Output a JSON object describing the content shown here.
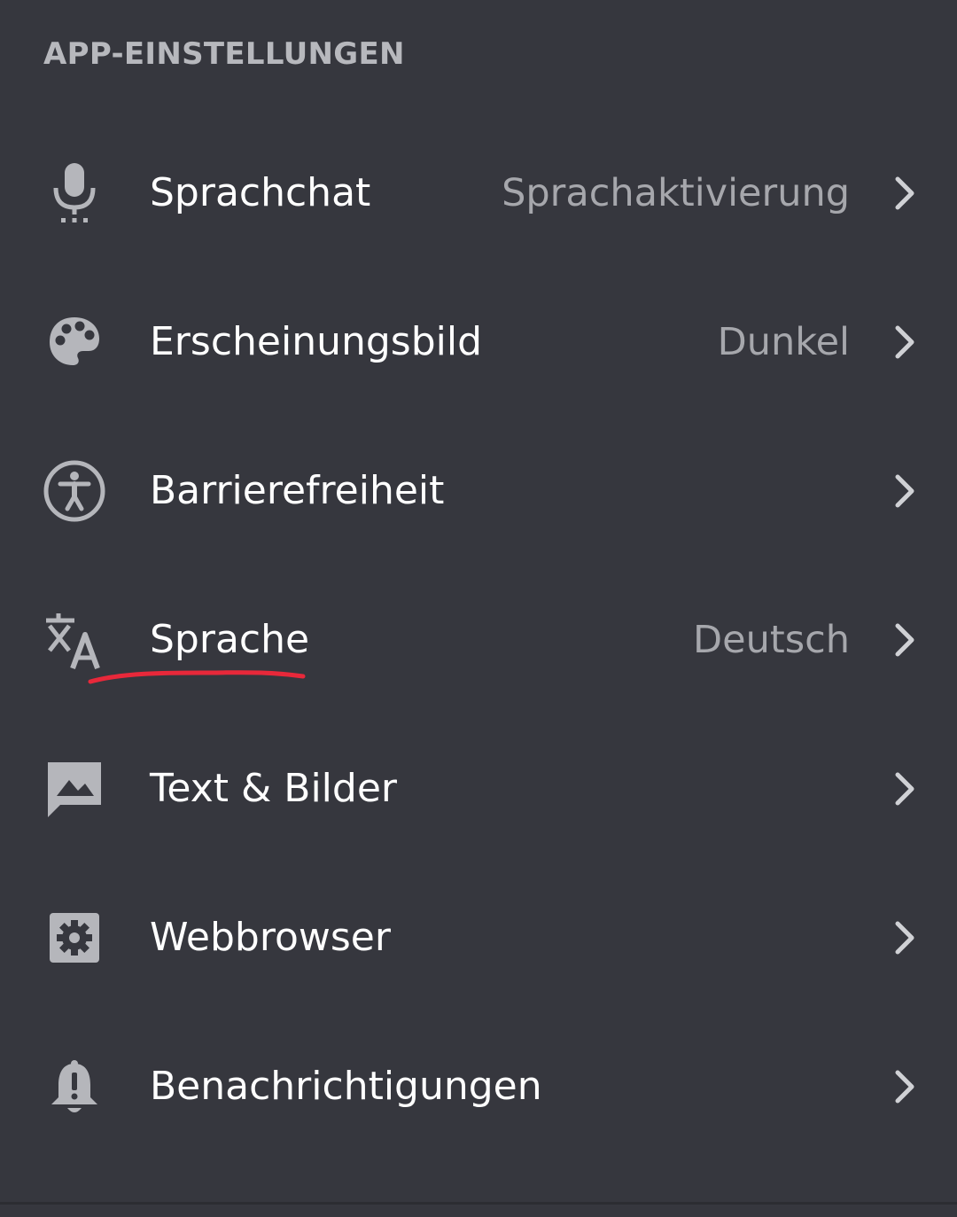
{
  "section": {
    "title": "APP-EINSTELLUNGEN"
  },
  "items": [
    {
      "label": "Sprachchat",
      "value": "Sprachaktivierung",
      "icon": "microphone-icon"
    },
    {
      "label": "Erscheinungsbild",
      "value": "Dunkel",
      "icon": "palette-icon"
    },
    {
      "label": "Barrierefreiheit",
      "value": "",
      "icon": "accessibility-icon"
    },
    {
      "label": "Sprache",
      "value": "Deutsch",
      "icon": "translate-icon"
    },
    {
      "label": "Text & Bilder",
      "value": "",
      "icon": "image-message-icon"
    },
    {
      "label": "Webbrowser",
      "value": "",
      "icon": "browser-gear-icon"
    },
    {
      "label": "Benachrichtigungen",
      "value": "",
      "icon": "bell-alert-icon"
    }
  ],
  "colors": {
    "background": "#36373e",
    "header_text": "#b7b8bd",
    "label_text": "#ffffff",
    "value_text": "#a6a7ac",
    "icon": "#b5b6bb",
    "chevron": "#d0d1d5",
    "annotation": "#e8283a"
  }
}
